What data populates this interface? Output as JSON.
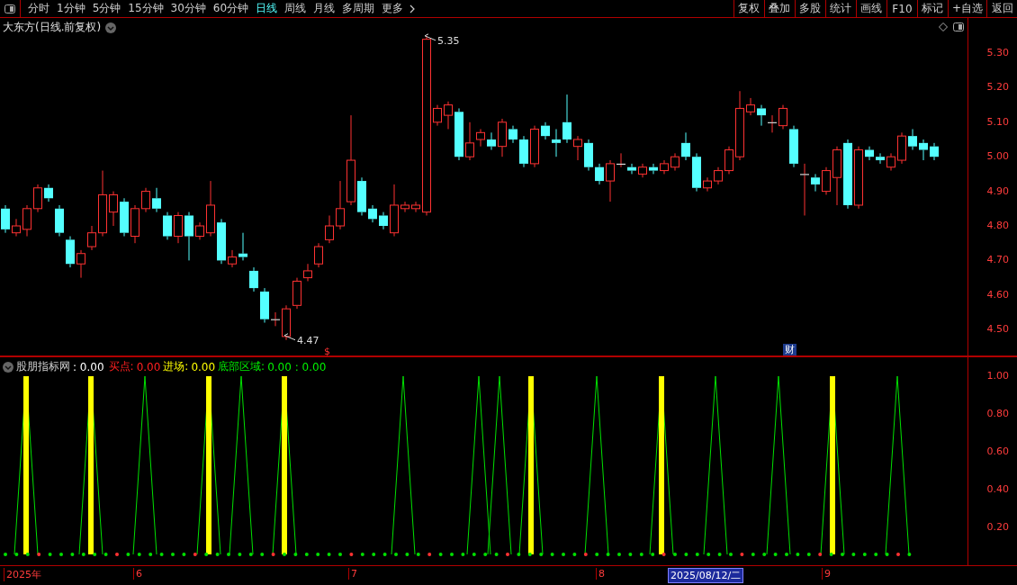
{
  "toolbar": {
    "periods": [
      {
        "label": "分时",
        "selected": false
      },
      {
        "label": "1分钟",
        "selected": false
      },
      {
        "label": "5分钟",
        "selected": false
      },
      {
        "label": "15分钟",
        "selected": false
      },
      {
        "label": "30分钟",
        "selected": false
      },
      {
        "label": "60分钟",
        "selected": false
      },
      {
        "label": "日线",
        "selected": true
      },
      {
        "label": "周线",
        "selected": false
      },
      {
        "label": "月线",
        "selected": false
      },
      {
        "label": "多周期",
        "selected": false
      },
      {
        "label": "更多",
        "selected": false
      }
    ],
    "buttons": [
      "复权",
      "叠加",
      "多股",
      "统计",
      "画线",
      "F10",
      "标记",
      "+自选",
      "返回"
    ]
  },
  "chart": {
    "title": "大东方(日线.前复权)",
    "price_axis": [
      "5.30",
      "5.20",
      "5.10",
      "5.00",
      "4.90",
      "4.80",
      "4.70",
      "4.60",
      "4.50"
    ],
    "high_label": "5.35",
    "low_label": "4.47",
    "markers": [
      {
        "kind": "dollar",
        "text": "$"
      },
      {
        "kind": "finance",
        "text": "财"
      }
    ]
  },
  "indicator": {
    "name": "股朋指标网",
    "value": ": 0.00",
    "lines": [
      {
        "label": "买点:",
        "value": "0.00",
        "kind": "buy"
      },
      {
        "label": "进场:",
        "value": "0.00",
        "kind": "entry"
      },
      {
        "label": "底部区域:",
        "value": "0.00 : 0.00",
        "kind": "bottom"
      }
    ],
    "axis": [
      "1.00",
      "0.80",
      "0.60",
      "0.40",
      "0.20"
    ]
  },
  "time_axis": [
    {
      "label": "2025年",
      "selected": false
    },
    {
      "label": "6",
      "selected": false
    },
    {
      "label": "7",
      "selected": false
    },
    {
      "label": "8",
      "selected": false
    },
    {
      "label": "2025/08/12/二",
      "selected": true
    },
    {
      "label": "9",
      "selected": false
    }
  ]
}
